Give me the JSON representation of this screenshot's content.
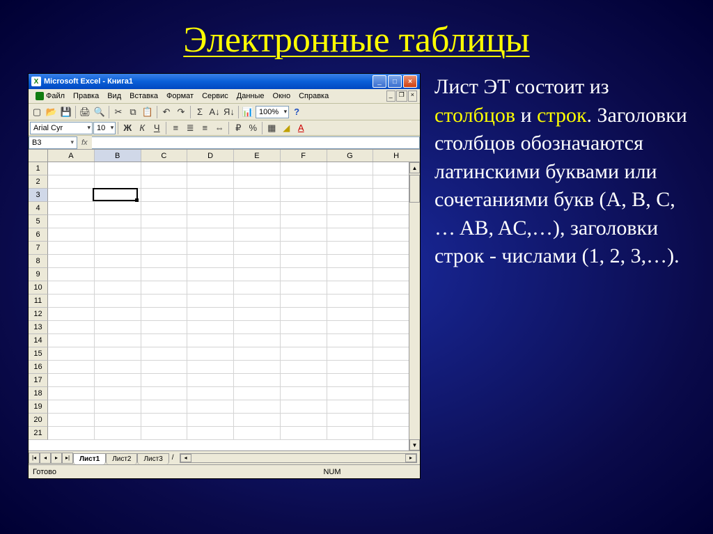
{
  "slide": {
    "title": "Электронные таблицы",
    "body": {
      "t1": "Лист ЭТ состоит из ",
      "hl1": "столбцов",
      "t2": " и ",
      "hl2": "строк",
      "t3": ". Заголовки столбцов обозначаются латинскими буквами или сочетаниями букв (A, B, C, … AB, AC,…), заголовки строк  - числами (1, 2, 3,…)."
    }
  },
  "excel": {
    "title": "Microsoft Excel - Книга1",
    "menu": [
      "Файл",
      "Правка",
      "Вид",
      "Вставка",
      "Формат",
      "Сервис",
      "Данные",
      "Окно",
      "Справка"
    ],
    "font_name": "Arial Cyr",
    "font_size": "10",
    "zoom": "100%",
    "name_box": "B3",
    "fx": "fx",
    "columns": [
      "A",
      "B",
      "C",
      "D",
      "E",
      "F",
      "G",
      "H"
    ],
    "rows": [
      "1",
      "2",
      "3",
      "4",
      "5",
      "6",
      "7",
      "8",
      "9",
      "10",
      "11",
      "12",
      "13",
      "14",
      "15",
      "16",
      "17",
      "18",
      "19",
      "20",
      "21"
    ],
    "sheets": [
      "Лист1",
      "Лист2",
      "Лист3"
    ],
    "active_sheet": 0,
    "active_col": 1,
    "active_row": 2,
    "status_ready": "Готово",
    "status_num": "NUM",
    "fmt": {
      "bold": "Ж",
      "italic": "К",
      "underline": "Ч"
    }
  }
}
